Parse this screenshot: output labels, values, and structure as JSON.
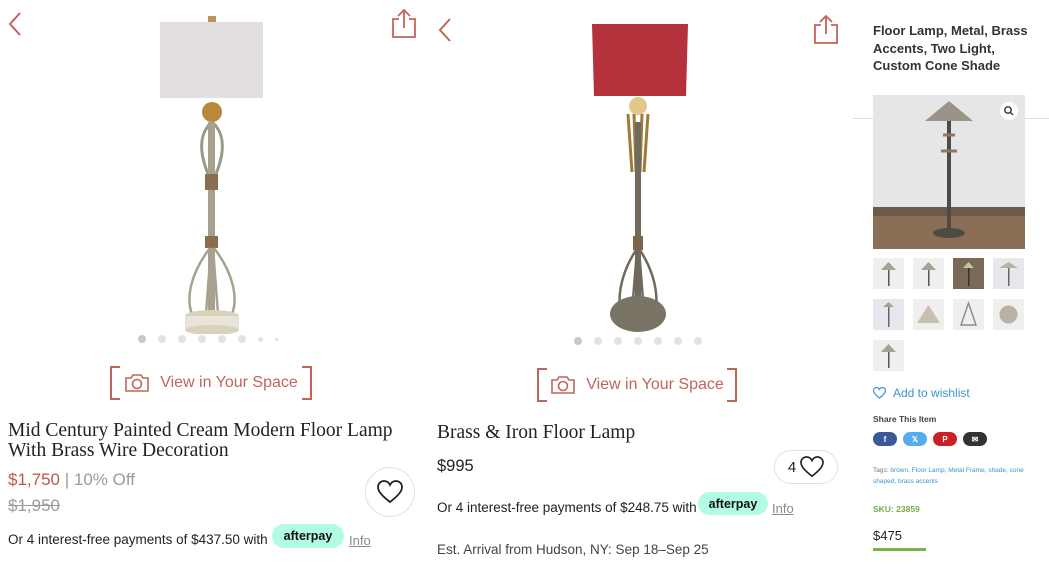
{
  "panel1": {
    "view_in_space": "View in Your Space",
    "title": "Mid Century Painted Cream Modern Floor Lamp With Brass Wire Decoration",
    "price": "$1,750",
    "separator": "|",
    "discount": "10% Off",
    "original_price": "$1,950",
    "payments_text": "Or 4 interest-free payments of $437.50 with",
    "afterpay_label": "afterpay",
    "info_label": "Info",
    "shade_color": "#e3dfdf",
    "dots_total": 8,
    "dots_active": 0
  },
  "panel2": {
    "view_in_space": "View in Your Space",
    "title": "Brass & Iron Floor Lamp",
    "price": "$995",
    "favorites_count": "4",
    "payments_text": "Or 4 interest-free payments of $248.75 with",
    "afterpay_label": "afterpay",
    "info_label": "Info",
    "arrival_text": "Est. Arrival from Hudson, NY: Sep 18–Sep 25",
    "shade_color": "#b5323d",
    "dots_total": 7,
    "dots_active": 0
  },
  "panel3": {
    "title": "Floor Lamp, Metal, Brass Accents, Two Light, Custom Cone Shade",
    "wishlist_label": "Add to wishlist",
    "share_label": "Share This Item",
    "share_buttons": [
      {
        "name": "facebook",
        "glyph": "f",
        "color": "#3b5998"
      },
      {
        "name": "twitter",
        "glyph": "𝕏",
        "color": "#55acee"
      },
      {
        "name": "pinterest",
        "glyph": "P",
        "color": "#cb2027"
      },
      {
        "name": "email",
        "glyph": "✉",
        "color": "#333333"
      }
    ],
    "tags_label": "Tags:",
    "tags": [
      "brown",
      "Floor Lamp",
      "Metal Frame",
      "shade",
      "cone shaped",
      "brass accents"
    ],
    "sku": "SKU: 23859",
    "price": "$475",
    "thumbnail_count": 9
  },
  "colors": {
    "accent": "#c0655b",
    "sale_red": "#c0554b",
    "afterpay_mint": "#b2fce4",
    "link_blue": "#3a96c8",
    "sku_green": "#7cae4a"
  },
  "icons": {
    "back": "chevron-left-icon",
    "share": "share-icon",
    "camera": "camera-icon",
    "heart": "heart-icon",
    "zoom": "magnifier-icon"
  }
}
